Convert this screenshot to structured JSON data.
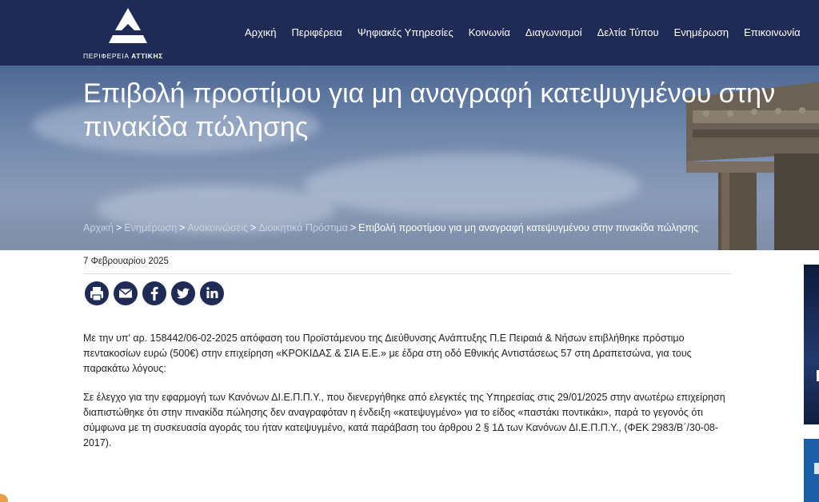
{
  "header": {
    "logo": {
      "text_regular": "ΠΕΡΙΦΕΡΕΙΑ ",
      "text_bold": "ΑΤΤΙΚΗΣ"
    },
    "nav": [
      {
        "label": "Αρχική"
      },
      {
        "label": "Περιφέρεια"
      },
      {
        "label": "Ψηφιακές Υπηρεσίες"
      },
      {
        "label": "Κοινωνία"
      },
      {
        "label": "Διαγωνισμοί"
      },
      {
        "label": "Δελτία Τύπου"
      },
      {
        "label": "Ενημέρωση"
      },
      {
        "label": "Επικοινωνία"
      }
    ]
  },
  "hero": {
    "title": "Επιβολή προστίμου για μη αναγραφή κατεψυγμένου στην πινακίδα πώλησης",
    "breadcrumb": [
      {
        "label": "Αρχική"
      },
      {
        "label": "Ενημέρωση"
      },
      {
        "label": "Ανακοινώσεις"
      },
      {
        "label": "Διοικητικά Πρόστιμα"
      }
    ],
    "breadcrumb_separator": ">",
    "breadcrumb_current": "Επιβολή προστίμου για μη αναγραφή κατεψυγμένου στην πινακίδα πώλησης"
  },
  "article": {
    "date": "7 Φεβρουαρίου 2025",
    "share": [
      {
        "icon": "print-icon"
      },
      {
        "icon": "email-icon"
      },
      {
        "icon": "facebook-icon"
      },
      {
        "icon": "twitter-icon"
      },
      {
        "icon": "linkedin-icon"
      }
    ],
    "paragraphs": [
      "Με την υπ' αρ. 158442/06-02-2025 απόφαση του Προϊστάμενου της Διεύθυνσης Ανάπτυξης Π.Ε Πειραιά & Νήσων επιβλήθηκε πρόστιμο πεντακοσίων ευρώ (500€) στην επιχείρηση «ΚΡΟΚΙΔΑΣ & ΣΙΑ Ε.Ε.» με έδρα στη οδό Εθνικής Αντιστάσεως  57 στη Δραπετσώνα,  για τους παρακάτω λόγους:",
      "Σε έλεγχο για την εφαρμογή των Κανόνων ΔΙ.Ε.Π.Π.Υ., που διενεργήθηκε από ελεγκτές της Υπηρεσίας στις 29/01/2025 στην ανωτέρω επιχείρηση διαπιστώθηκε ότι στην πινακίδα πώλησης δεν αναγραφόταν η ένδειξη «κατεψυγμένο» για το είδος «παστάκι ποντικάκι», παρά το γεγονός ότι σύμφωνα με τη συσκευασία αγοράς του ήταν κατεψυγμένο, κατά παράβαση του άρθρου 2 § 1Δ των Κανόνων ΔΙ.Ε.Π.Π.Υ., (ΦΕΚ 2983/Β΄/30-08-2017)."
    ]
  },
  "colors": {
    "header_bg": "#1f2b55",
    "share_icon": "#1f2b55",
    "hero_text": "#ffffff"
  }
}
